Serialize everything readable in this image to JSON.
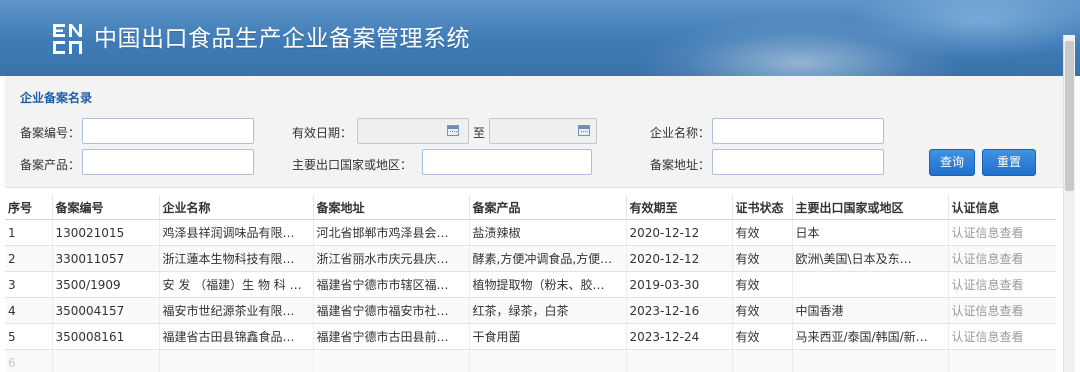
{
  "header": {
    "logo_icon": "ens-logo-icon",
    "title": "中国出口食品生产企业备案管理系统"
  },
  "search": {
    "panel_title": "企业备案名录",
    "record_no_label": "备案编号：",
    "record_no_value": "",
    "valid_date_label": "有效日期：",
    "date_from_value": "",
    "date_to_label": "至",
    "date_to_value": "",
    "company_name_label": "企业名称：",
    "company_name_value": "",
    "product_label": "备案产品：",
    "product_value": "",
    "export_region_label": "主要出口国家或地区：",
    "export_region_value": "",
    "address_label": "备案地址：",
    "address_value": "",
    "query_button": "查询",
    "reset_button": "重置"
  },
  "table": {
    "columns": [
      "序号",
      "备案编号",
      "企业名称",
      "备案地址",
      "备案产品",
      "有效期至",
      "证书状态",
      "主要出口国家或地区",
      "认证信息"
    ],
    "rows": [
      [
        "1",
        "130021015",
        "鸡泽县祥润调味品有限…",
        "河北省邯郸市鸡泽县会…",
        "盐渍辣椒",
        "2020-12-12",
        "有效",
        "日本",
        "认证信息查看"
      ],
      [
        "2",
        "330011057",
        "浙江蓮本生物科技有限…",
        "浙江省丽水市庆元县庆…",
        "酵素,方便冲调食品,方便…",
        "2020-12-12",
        "有效",
        "欧洲\\美国\\日本及东…",
        "认证信息查看"
      ],
      [
        "3",
        "3500/1909",
        "安 发 （福建）生 物 科 …",
        "福建省宁德市市辖区福…",
        "植物提取物（粉末、胶…",
        "2019-03-30",
        "有效",
        "",
        "认证信息查看"
      ],
      [
        "4",
        "350004157",
        "福安市世纪源茶业有限…",
        "福建省宁德市福安市社…",
        "红茶，绿茶，白茶",
        "2023-12-16",
        "有效",
        "中国香港",
        "认证信息查看"
      ],
      [
        "5",
        "350008161",
        "福建省古田县锦鑫食品…",
        "福建省宁德市古田县前…",
        "干食用菌",
        "2023-12-24",
        "有效",
        "马来西亚/泰国/韩国/新…",
        "认证信息查看"
      ],
      [
        "6",
        "",
        "",
        "",
        "",
        "",
        "",
        "",
        ""
      ]
    ]
  },
  "colors": {
    "header_blue": "#3f7bb6",
    "panel_title_blue": "#1f5fa6",
    "button_blue": "#2b7fd8",
    "link_gray": "#9b9b9b"
  }
}
